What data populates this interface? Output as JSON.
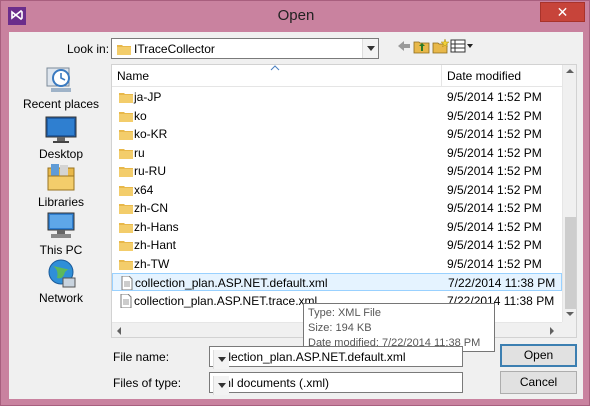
{
  "window": {
    "title": "Open",
    "close_label": "✕"
  },
  "toolbar": {
    "look_in_label": "Look in:",
    "look_in_value": "ITraceCollector"
  },
  "places": [
    {
      "label": "Recent places",
      "icon": "recent-places-icon"
    },
    {
      "label": "Desktop",
      "icon": "desktop-icon"
    },
    {
      "label": "Libraries",
      "icon": "libraries-icon"
    },
    {
      "label": "This PC",
      "icon": "this-pc-icon"
    },
    {
      "label": "Network",
      "icon": "network-icon"
    }
  ],
  "list": {
    "columns": {
      "name": "Name",
      "date": "Date modified"
    },
    "rows": [
      {
        "type": "folder",
        "name": "ja-JP",
        "date": "9/5/2014 1:52 PM"
      },
      {
        "type": "folder",
        "name": "ko",
        "date": "9/5/2014 1:52 PM"
      },
      {
        "type": "folder",
        "name": "ko-KR",
        "date": "9/5/2014 1:52 PM"
      },
      {
        "type": "folder",
        "name": "ru",
        "date": "9/5/2014 1:52 PM"
      },
      {
        "type": "folder",
        "name": "ru-RU",
        "date": "9/5/2014 1:52 PM"
      },
      {
        "type": "folder",
        "name": "x64",
        "date": "9/5/2014 1:52 PM"
      },
      {
        "type": "folder",
        "name": "zh-CN",
        "date": "9/5/2014 1:52 PM"
      },
      {
        "type": "folder",
        "name": "zh-Hans",
        "date": "9/5/2014 1:52 PM"
      },
      {
        "type": "folder",
        "name": "zh-Hant",
        "date": "9/5/2014 1:52 PM"
      },
      {
        "type": "folder",
        "name": "zh-TW",
        "date": "9/5/2014 1:52 PM"
      },
      {
        "type": "file",
        "name": "collection_plan.ASP.NET.default.xml",
        "date": "7/22/2014 11:38 PM",
        "selected": true
      },
      {
        "type": "file",
        "name": "collection_plan.ASP.NET.trace.xml",
        "date": "7/22/2014 11:38 PM"
      }
    ]
  },
  "tooltip": {
    "type": "Type: XML File",
    "size": "Size: 194 KB",
    "date": "Date modified: 7/22/2014 11:38 PM"
  },
  "form": {
    "file_name_label": "File name:",
    "file_name_value": "collection_plan.ASP.NET.default.xml",
    "file_type_label": "Files of type:",
    "file_type_value": "Xml documents (.xml)"
  },
  "buttons": {
    "open": "Open",
    "cancel": "Cancel"
  },
  "colors": {
    "frame": "#c9829f",
    "selection": "#e5f3ff",
    "selection_border": "#99d1ff",
    "folder": "#e8b84a"
  }
}
